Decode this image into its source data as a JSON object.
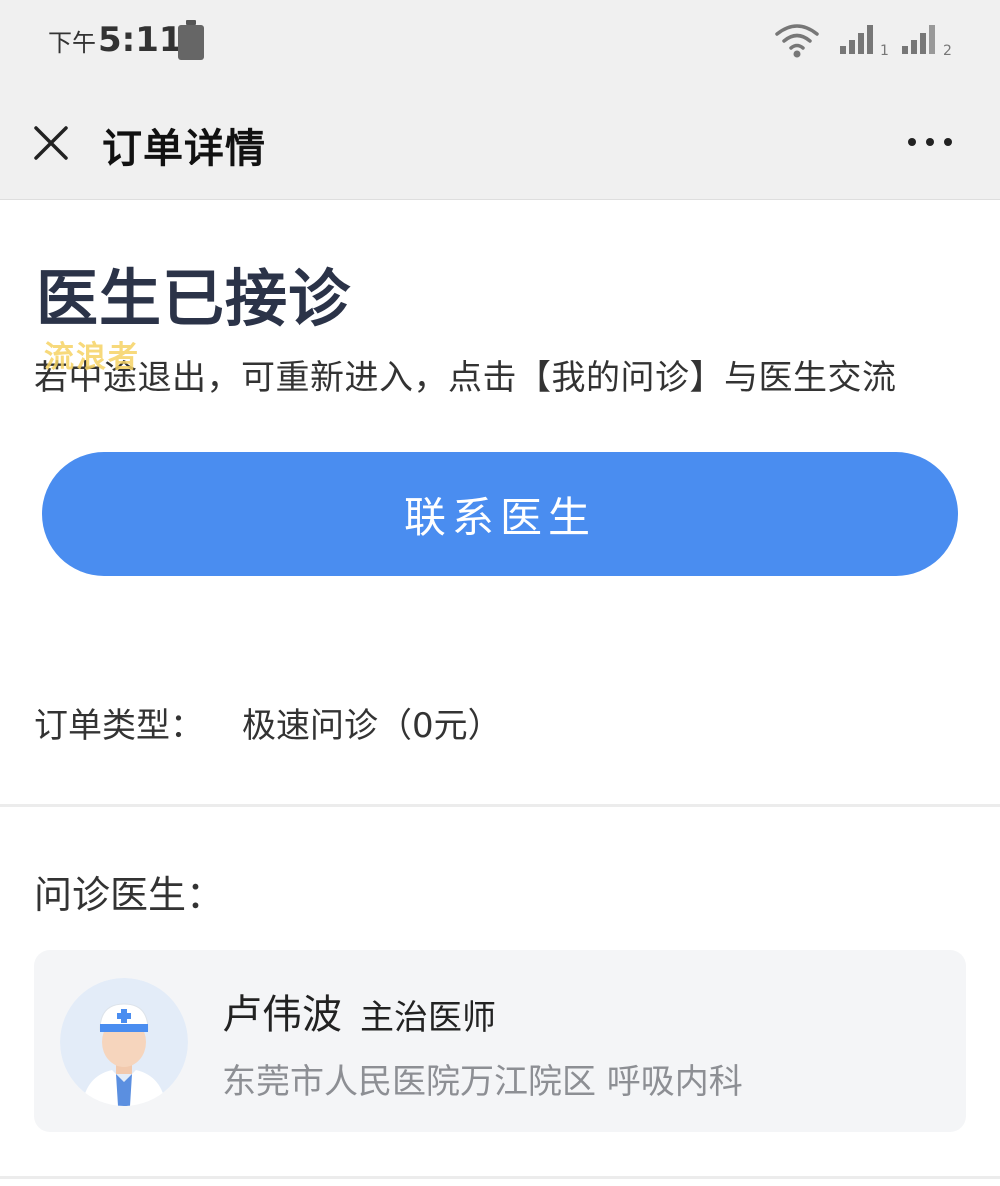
{
  "status_bar": {
    "ampm": "下午",
    "time": "5:11",
    "signal1_index": "1",
    "signal2_index": "2"
  },
  "nav": {
    "title": "订单详情"
  },
  "order_status": {
    "title": "医生已接诊",
    "hint": "若中途退出，可重新进入，点击【我的问诊】与医生交流",
    "watermark": "流浪者"
  },
  "actions": {
    "contact_doctor": "联系医生"
  },
  "order_info": {
    "type_label": "订单类型：",
    "type_value": "极速问诊（0元）"
  },
  "doctor": {
    "section_label": "问诊医生：",
    "name": "卢伟波",
    "title": "主治医师",
    "hospital": "东莞市人民医院万江院区 呼吸内科"
  },
  "colors": {
    "primary": "#4a8df0",
    "status_title": "#2b3348",
    "card_bg": "#f4f5f7",
    "muted_text": "#8d8f94"
  }
}
